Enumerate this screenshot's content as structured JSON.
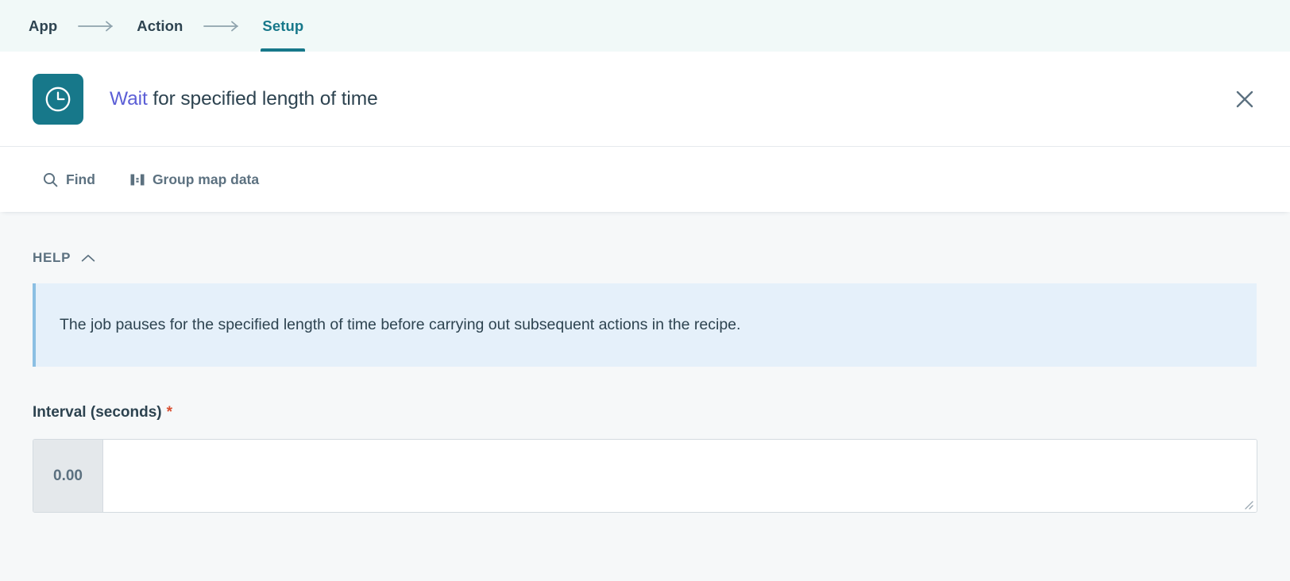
{
  "steps": {
    "items": [
      {
        "label": "App",
        "active": false
      },
      {
        "label": "Action",
        "active": false
      },
      {
        "label": "Setup",
        "active": true
      }
    ],
    "separator_icon": "arrow-right-icon",
    "active_color": "#17788a",
    "background": "#f1f9f8"
  },
  "action_header": {
    "icon": "clock-icon",
    "icon_background": "#17788a",
    "app_name": "Wait",
    "app_name_color": "#5c5fd6",
    "title_rest": " for specified length of time",
    "close_icon": "close-icon"
  },
  "toolbar": {
    "find_label": "Find",
    "find_icon": "search-icon",
    "group_label": "Group map data",
    "group_icon": "group-map-data-icon"
  },
  "help": {
    "label": "HELP",
    "toggle_icon": "chevron-up-icon",
    "expanded": true,
    "text": "The job pauses for the specified length of time before carrying out subsequent actions in the recipe.",
    "background": "#e5f0fa",
    "accent_color": "#8bbfe3"
  },
  "form": {
    "field_label": "Interval (seconds)",
    "required_marker": "*",
    "required_marker_color": "#d94f32",
    "input_prefix": "0.00",
    "input_value": "",
    "input_placeholder": ""
  }
}
